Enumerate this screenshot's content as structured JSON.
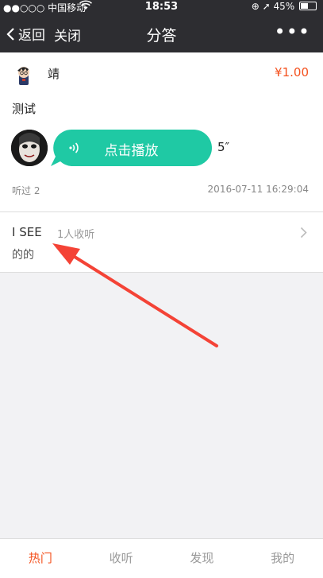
{
  "status_bar": {
    "carrier": "●●○○○ 中国移动",
    "time": "18:53",
    "battery": "45%"
  },
  "nav": {
    "back_label": "返回",
    "close_label": "关闭",
    "title": "分答",
    "more_label": "•••"
  },
  "question_card": {
    "asker_name": "靖",
    "price": "¥1.00",
    "question_text": "测试",
    "play_label": "点击播放",
    "duration": "5″",
    "listened": "听过 2",
    "timestamp": "2016-07-11 16:29:04"
  },
  "answerer": {
    "name": "I SEE",
    "listen_count": "1人收听",
    "intro": "的的"
  },
  "tabs": [
    {
      "label": "热门",
      "active": true
    },
    {
      "label": "收听",
      "active": false
    },
    {
      "label": "发现",
      "active": false
    },
    {
      "label": "我的",
      "active": false
    }
  ],
  "colors": {
    "accent": "#f4511e",
    "bubble": "#1fc9a4",
    "navbar": "#2d2d31",
    "annotation_arrow": "#f44336"
  }
}
